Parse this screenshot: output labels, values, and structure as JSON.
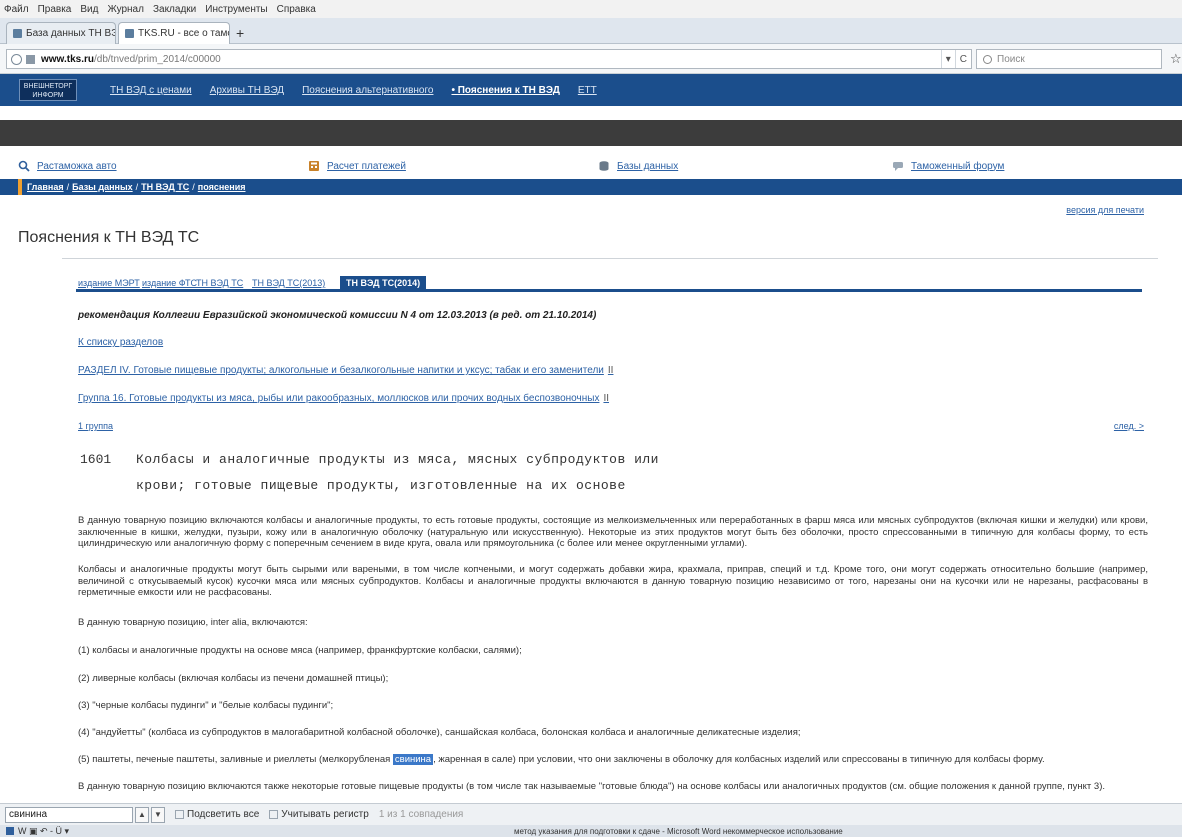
{
  "menubar": [
    "Файл",
    "Правка",
    "Вид",
    "Журнал",
    "Закладки",
    "Инструменты",
    "Справка"
  ],
  "tabs": [
    {
      "label": "База данных ТН ВЭД ЕАЭ...",
      "active": false
    },
    {
      "label": "TKS.RU - все о таможне б...",
      "active": true
    }
  ],
  "newtab_label": "+",
  "nav": {
    "url_domain": "www.tks.ru",
    "url_path": "/db/tnved/prim_2014/c00000",
    "url_controls": [
      "▾",
      "C",
      "Q Поиск"
    ],
    "search_placeholder": "Поиск",
    "star": "☆"
  },
  "site": {
    "logo_text": "ВНЕШНЕТОРГ ИНФОРМ",
    "top_nav": [
      {
        "label": "ТН ВЭД с ценами",
        "strong": false
      },
      {
        "label": "Архивы ТН ВЭД",
        "strong": false
      },
      {
        "label": "Пояснения альтернативного",
        "strong": false
      },
      {
        "label": "• Пояснения к ТН ВЭД",
        "strong": true
      },
      {
        "label": "ЕТТ",
        "strong": false
      }
    ],
    "icon_links": [
      {
        "label": "Растаможка авто",
        "icon": "search-icon",
        "color": "#2f5f9c"
      },
      {
        "label": "Расчет платежей",
        "icon": "calculator-icon",
        "color": "#c9822a"
      },
      {
        "label": "Базы данных",
        "icon": "database-icon",
        "color": "#6a7a8a"
      },
      {
        "label": "Таможенный форум",
        "icon": "forum-icon",
        "color": "#9aa8b6"
      }
    ],
    "breadcrumb": [
      "Главная",
      "Базы данных",
      "ТН ВЭД ТС",
      "пояснения"
    ],
    "print_link": "версия для печати",
    "page_title": "Пояснения к ТН ВЭД ТС"
  },
  "edition_tabs": [
    {
      "label": "издание МЭРТ",
      "active": false
    },
    {
      "label": "издание ФТС",
      "active": false
    },
    {
      "label": "ТН ВЭД ТС",
      "active": false
    },
    {
      "label": "ТН ВЭД ТС(2013)",
      "active": false
    },
    {
      "label": "ТН ВЭД ТС(2014)",
      "active": true
    }
  ],
  "content": {
    "decree": "рекомендация Коллегии Евразийской экономической комиссии N 4 от 12.03.2013 (в ред. от 21.10.2014)",
    "links": [
      {
        "label": "К списку разделов",
        "marker": ""
      },
      {
        "label": "РАЗДЕЛ IV. Готовые пищевые продукты; алкогольные и безалкогольные напитки и уксус; табак и его заменители",
        "marker": "II"
      },
      {
        "label": "Группа 16. Готовые продукты из мяса, рыбы или ракообразных, моллюсков или прочих водных беспозвоночных",
        "marker": "II"
      }
    ],
    "prev_link": "1 группа",
    "next_link": "след. >",
    "hs_code": "1601",
    "hs_title_lines": [
      "Колбасы и аналогичные продукты из мяса, мясных субпродуктов или",
      "крови; готовые пищевые продукты, изготовленные на их основе"
    ],
    "paragraphs": [
      "В данную товарную позицию включаются колбасы и аналогичные продукты, то есть готовые продукты, состоящие из мелкоизмельченных или переработанных в фарш мяса или мясных субпродуктов (включая кишки и желудки) или крови, заключенные в кишки, желудки, пузыри, кожу или в аналогичную оболочку (натуральную или искусственную). Некоторые из этих продуктов могут быть без оболочки, просто спрессованными в типичную для колбасы форму, то есть цилиндрическую или аналогичную форму с поперечным сечением в виде круга, овала или прямоугольника (с более или менее округленными углами).",
      "Колбасы и аналогичные продукты могут быть сырыми или вареными, в том числе копчеными, и могут содержать добавки жира, крахмала, приправ, специй и т.д. Кроме того, они могут содержать относительно большие (например, величиной с откусываемый кусок) кусочки мяса или мясных субпродуктов. Колбасы и аналогичные продукты включаются в данную товарную позицию независимо от того, нарезаны они на кусочки или не нарезаны, расфасованы в герметичные емкости или не расфасованы.",
      "В данную товарную позицию, inter alia, включаются:",
      "(1) колбасы и аналогичные продукты на основе мяса (например, франкфуртские колбаски, салями);",
      "(2) ливерные колбасы (включая колбасы из печени домашней птицы);",
      "(3) \"черные колбасы пудинги\" и \"белые колбасы пудинги\";",
      "(4) \"андуйетты\" (колбаса из субпродуктов в малогабаритной колбасной оболочке), саншайская колбаса, болонская колбаса и аналогичные деликатесные изделия;"
    ],
    "para5_before": "(5) паштеты, печеные паштеты, заливные и риеллеты (мелкорубленая ",
    "para5_highlight": "свинина",
    "para5_after": ", жаренная в сале) при условии, что они заключены в оболочку для колбасных изделий или спрессованы в типичную для колбасы форму.",
    "last_paragraph": "В данную товарную позицию включаются также некоторые готовые пищевые продукты (в том числе так называемые \"готовые блюда\") на основе колбасы или аналогичных продуктов (см. общие положения к данной группе, пункт 3)."
  },
  "findbar": {
    "query": "свинина",
    "up": "▲",
    "down": "▼",
    "highlight_all": "Подсветить все",
    "match_case": "Учитывать регистр",
    "result": "1 из 1 совпадения"
  },
  "statusbar": {
    "left": "W ▣ ↶ - Ü ▾",
    "center": "метод указания для подготовки к сдаче - Microsoft Word некоммерческое использование"
  }
}
